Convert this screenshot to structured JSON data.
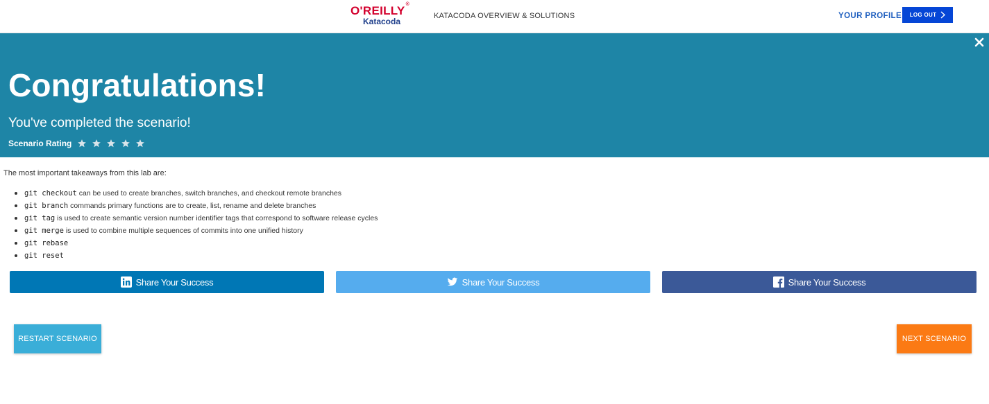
{
  "header": {
    "logo_brand": "O'REILLY",
    "logo_product": "Katacoda",
    "nav_overview": "KATACODA OVERVIEW & SOLUTIONS",
    "nav_profile": "YOUR PROFILE",
    "logout_label": "LOG OUT"
  },
  "banner": {
    "title": "Congratulations!",
    "subtitle": "You've completed the scenario!",
    "rating_label": "Scenario Rating",
    "stars_total": 5,
    "stars_selected": 0,
    "background_color": "#1e85a6"
  },
  "content": {
    "intro": "The most important takeaways from this lab are:",
    "takeaways": [
      {
        "code": "git checkout",
        "text": " can be used to create branches, switch branches, and checkout remote branches"
      },
      {
        "code": "git branch",
        "text": " commands primary functions are to create, list, rename and delete branches"
      },
      {
        "code": "git tag",
        "text": " is used to create semantic version number identifier tags that correspond to software release cycles"
      },
      {
        "code": "git merge",
        "text": " is used to combine multiple sequences of commits into one unified history"
      },
      {
        "code": "git rebase",
        "text": ""
      },
      {
        "code": "git reset",
        "text": ""
      }
    ]
  },
  "share": {
    "linkedin_label": "Share Your Success",
    "twitter_label": "Share Your Success",
    "facebook_label": "Share Your Success",
    "icons": [
      "linkedin-icon",
      "twitter-icon",
      "facebook-icon"
    ],
    "colors": {
      "linkedin": "#0077b5",
      "twitter": "#55acee",
      "facebook": "#3b5998"
    }
  },
  "actions": {
    "restart_label": "RESTART SCENARIO",
    "next_label": "NEXT SCENARIO",
    "restart_color": "#3aaed8",
    "next_color": "#fb7a14"
  }
}
